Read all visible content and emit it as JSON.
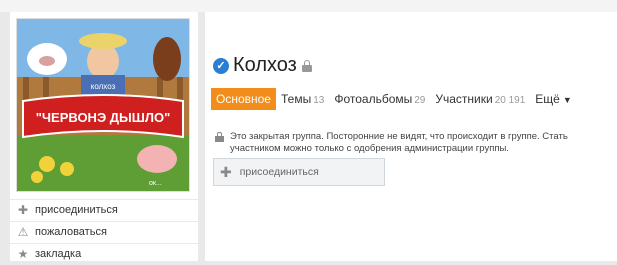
{
  "group": {
    "title": "Колхоз",
    "avatar_sign_text": "\"ЧЕРВОНЭ ДЫШЛО\"",
    "avatar_subtitle": "колхоз",
    "avatar_watermark": "ок..."
  },
  "tabs": [
    {
      "label": "Основное",
      "count": ""
    },
    {
      "label": "Темы",
      "count": "13"
    },
    {
      "label": "Фотоальбомы",
      "count": "29"
    },
    {
      "label": "Участники",
      "count": "20 191"
    },
    {
      "label": "Ещё",
      "count": ""
    }
  ],
  "notice": {
    "text": "Это закрытая группа. Посторонние не видят, что происходит в группе. Стать участником можно только с одобрения администрации группы."
  },
  "join_button": {
    "label": "присоединиться"
  },
  "side_menu": [
    {
      "label": "присоединиться",
      "icon": "plus-icon"
    },
    {
      "label": "пожаловаться",
      "icon": "warning-icon"
    },
    {
      "label": "закладка",
      "icon": "star-icon"
    }
  ],
  "colors": {
    "accent": "#f28c1a",
    "verified": "#2a7fd4"
  }
}
